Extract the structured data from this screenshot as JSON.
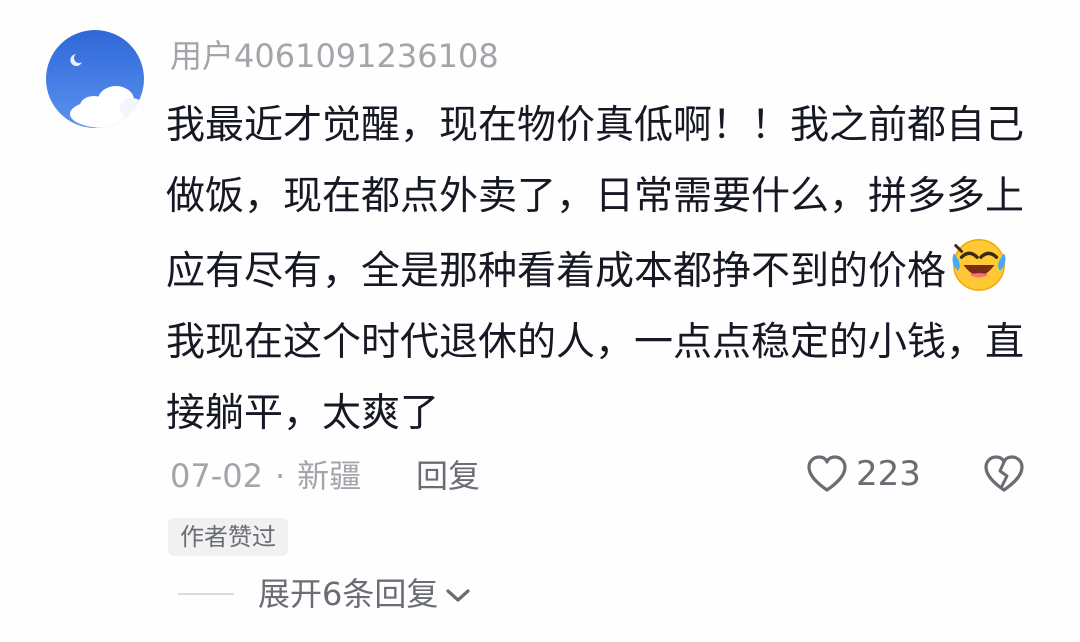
{
  "comment": {
    "username": "用户4061091236108",
    "text_before_emoji": "我最近才觉醒，现在物价真低啊！！我之前都自己做饭，现在都点外卖了，日常需要什么，拼多多上应有尽有，全是那种看着成本都挣不到的价格",
    "emoji": "laughing-crying-emoji",
    "text_after_emoji": "我现在这个时代退休的人，一点点稳定的小钱，直接躺平，太爽了",
    "date": "07-02",
    "separator": "·",
    "location": "新疆",
    "reply_label": "回复",
    "like_count": "223",
    "author_badge": "作者赞过",
    "expand_replies_label": "展开6条回复"
  },
  "icons": {
    "like": "heart-outline-icon",
    "dislike": "broken-heart-icon",
    "expand": "chevron-down-icon"
  },
  "colors": {
    "text_primary": "#161823",
    "text_secondary": "#a3a5ab",
    "text_action": "#6b6d74",
    "badge_bg": "#f1f1f2"
  }
}
